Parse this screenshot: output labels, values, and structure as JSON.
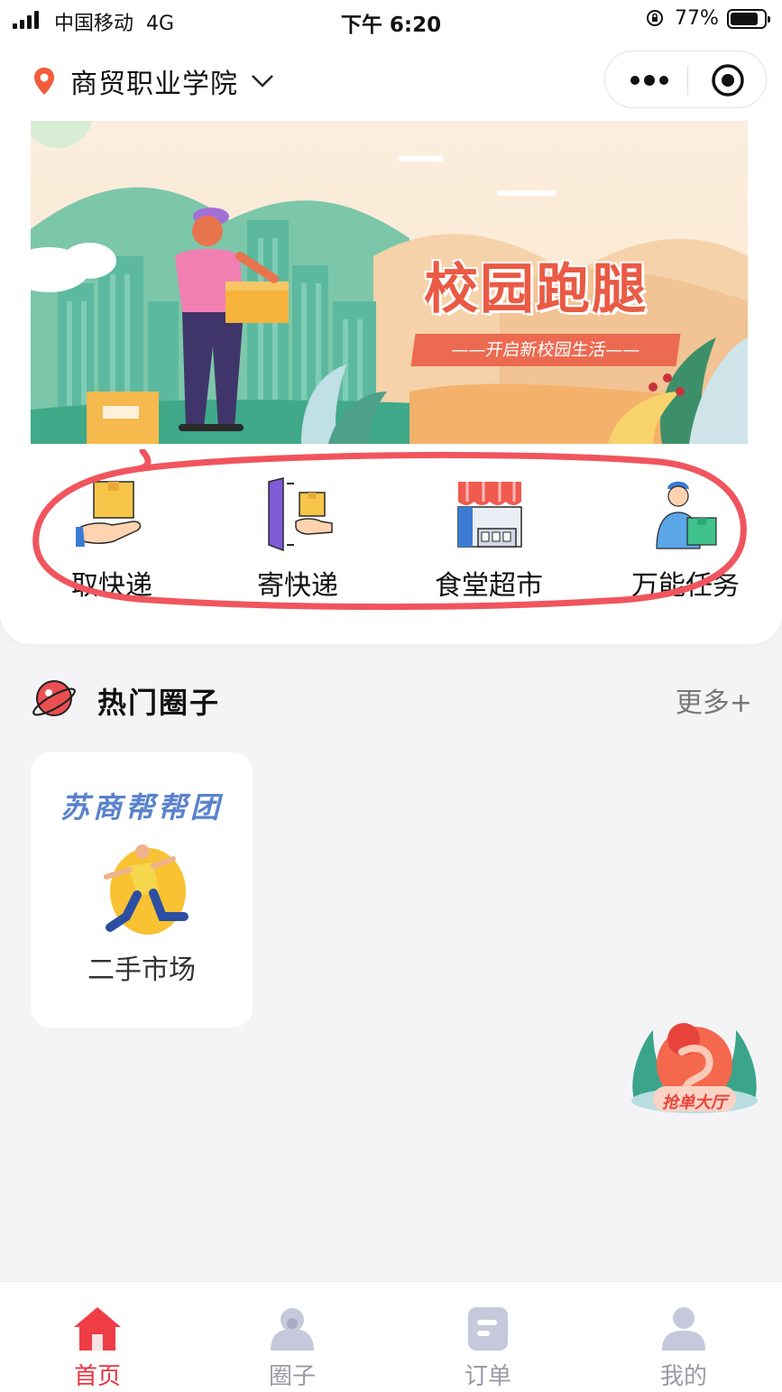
{
  "status_bar": {
    "carrier": "中国移动",
    "network": "4G",
    "time": "下午 6:20",
    "battery": "77%"
  },
  "header": {
    "location": "商贸职业学院"
  },
  "banner": {
    "title": "校园跑腿",
    "subtitle": "——开启新校园生活——"
  },
  "services": [
    {
      "label": "取快递",
      "icon": "package-in-hand-icon"
    },
    {
      "label": "寄快递",
      "icon": "send-package-door-icon"
    },
    {
      "label": "食堂超市",
      "icon": "storefront-icon"
    },
    {
      "label": "万能任务",
      "icon": "courier-person-icon"
    }
  ],
  "hot_circles": {
    "title": "热门圈子",
    "more": "更多+",
    "items": [
      {
        "brand": "苏商帮帮团",
        "label": "二手市场"
      }
    ]
  },
  "float_badge": {
    "label": "抢单大厅"
  },
  "tabbar": {
    "active_color": "#e8333e",
    "inactive_color": "#9a9aa8",
    "items": [
      {
        "label": "首页",
        "icon": "home-icon",
        "active": true
      },
      {
        "label": "圈子",
        "icon": "circle-people-icon",
        "active": false
      },
      {
        "label": "订单",
        "icon": "order-icon",
        "active": false
      },
      {
        "label": "我的",
        "icon": "profile-icon",
        "active": false
      }
    ]
  },
  "annotation_color": "#f0555e"
}
